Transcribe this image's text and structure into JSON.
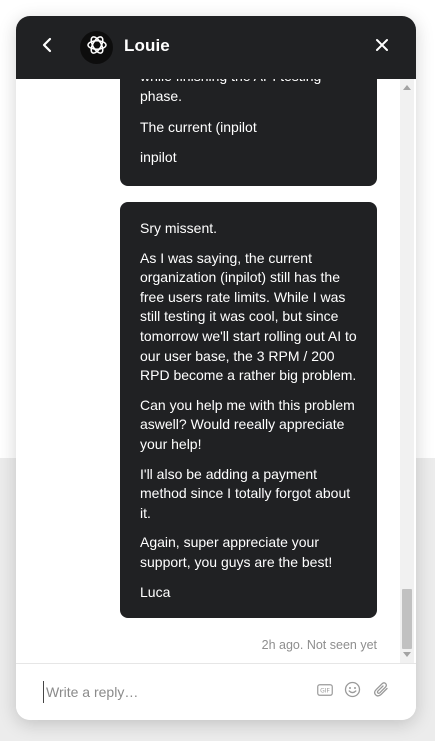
{
  "header": {
    "title": "Louie",
    "back_icon": "chevron-left-icon",
    "avatar_icon": "openai-logo-icon",
    "close_icon": "close-icon",
    "background": "#202123"
  },
  "messages": {
    "bubble_1": {
      "partial_text": "while finishing the API testing phase.",
      "line_2": "The current (inpilot",
      "line_3": "inpilot"
    },
    "bubble_2": {
      "paragraphs": [
        "Sry missent.",
        "As I was saying, the current organization (inpilot) still has the free users rate limits. While I was still testing it was cool, but since tomorrow we'll start rolling out AI to our user base, the 3 RPM / 200 RPD become a rather big problem.",
        "Can you help me with this problem aswell? Would reeally appreciate your help!",
        "I'll also be adding a payment method since I totally forgot about it.",
        "Again, super appreciate your support, you guys are the best!",
        "Luca"
      ]
    },
    "status": "2h ago. Not seen yet"
  },
  "composer": {
    "placeholder": "Write a reply…",
    "value": "",
    "gif_icon": "gif-icon",
    "emoji_icon": "emoji-icon",
    "attach_icon": "paperclip-icon"
  }
}
